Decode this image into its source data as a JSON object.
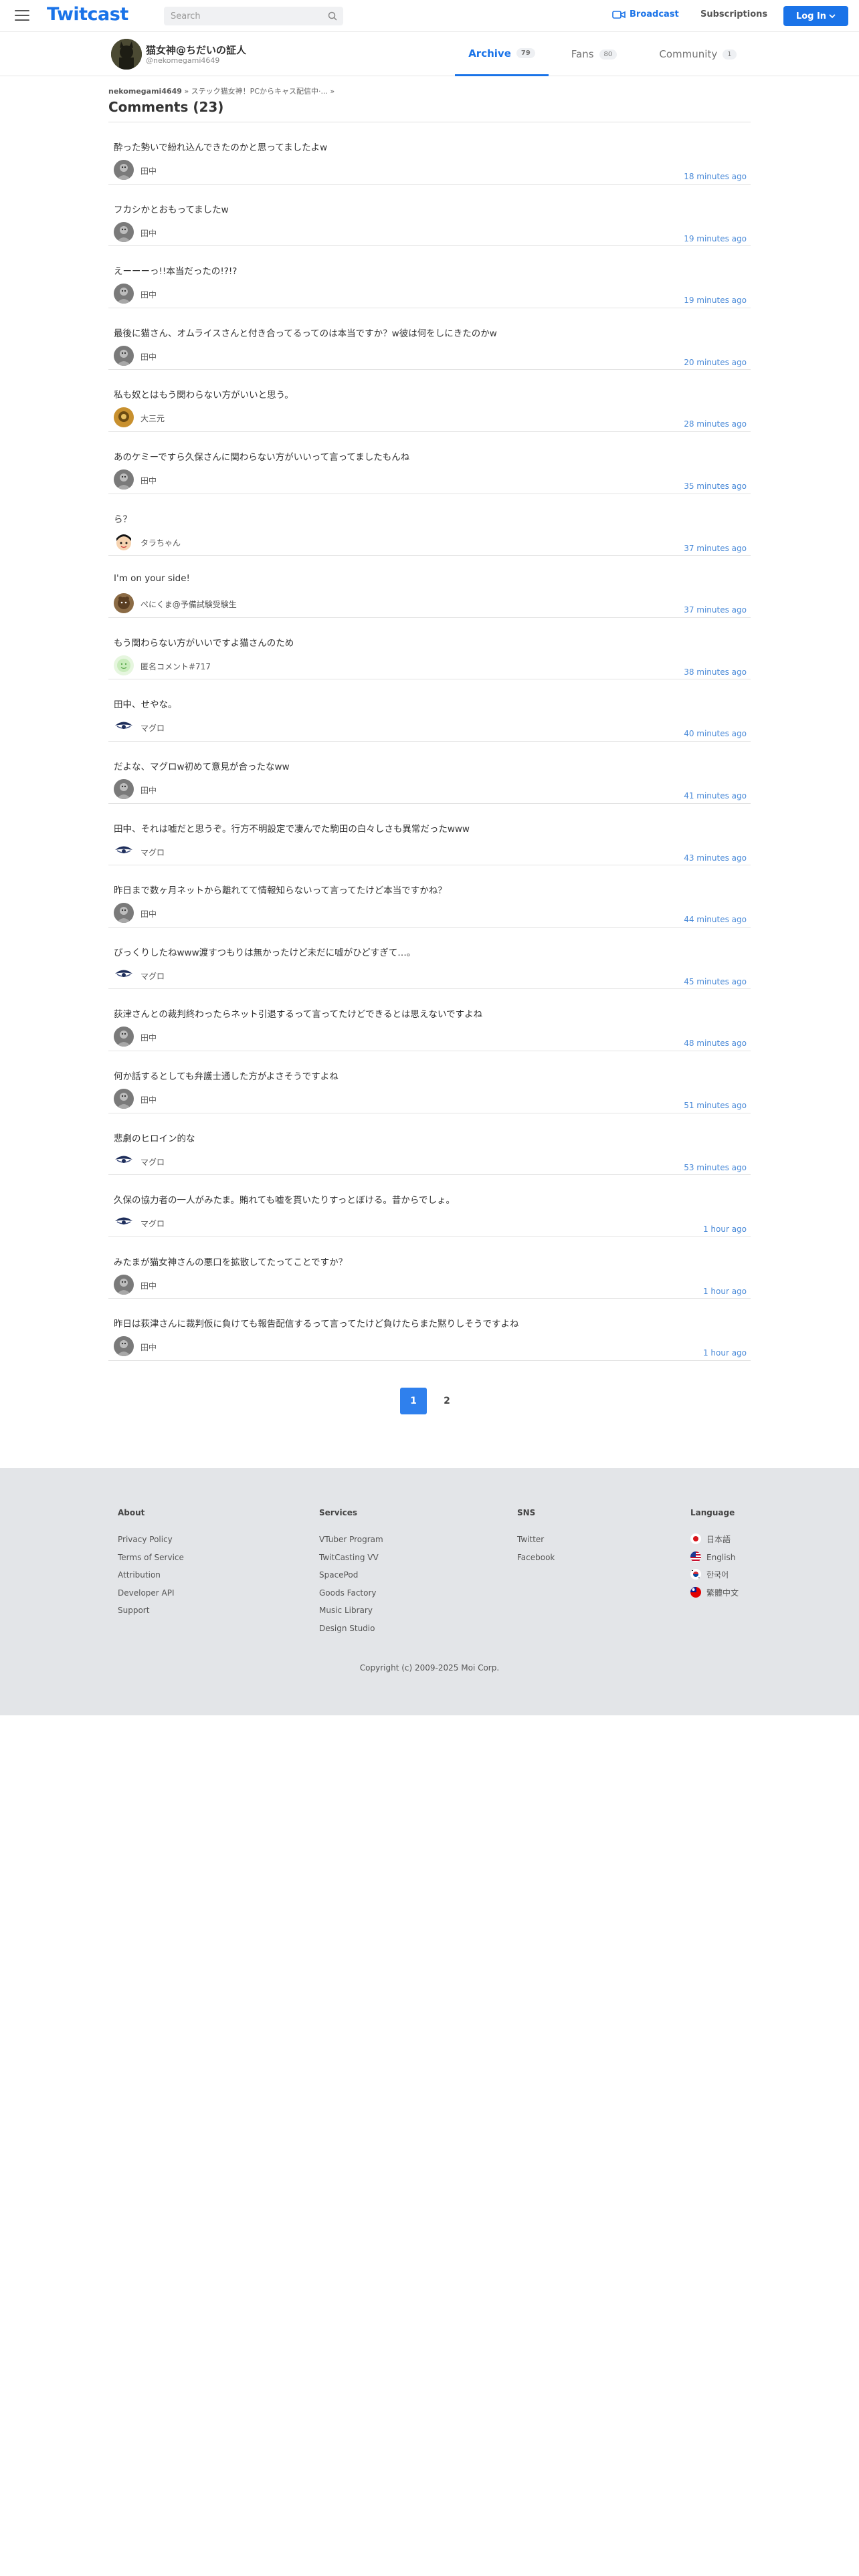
{
  "header": {
    "logo": "Twitcast",
    "search_placeholder": "Search",
    "broadcast_label": "Broadcast",
    "subscriptions_label": "Subscriptions",
    "login_label": "Log In",
    "accent": "#1a73e8"
  },
  "profile": {
    "name": "猫女神@ちだいの証人",
    "handle": "@nekomegami4649",
    "tabs": [
      {
        "label": "Archive",
        "count": "79",
        "active": true
      },
      {
        "label": "Fans",
        "count": "80",
        "active": false
      },
      {
        "label": "Community",
        "count": "1",
        "active": false
      }
    ]
  },
  "breadcrumb": {
    "user": "nekomegami4649",
    "sep1": "»",
    "movie": "ステック猫女神！PCからキャス配信中·...",
    "sep2": "»"
  },
  "comments_title": "Comments (23)",
  "comments": [
    {
      "text": "酔った勢いで紛れ込んできたのかと思ってましたよw",
      "user": "田中",
      "time": "18 minutes ago",
      "avatar": "gray"
    },
    {
      "text": "フカシかとおもってましたw",
      "user": "田中",
      "time": "19 minutes ago",
      "avatar": "gray"
    },
    {
      "text": "えーーーっ!!本当だったの!?!?",
      "user": "田中",
      "time": "19 minutes ago",
      "avatar": "gray"
    },
    {
      "text": "最後に猫さん、オムライスさんと付き合ってるってのは本当ですか？w彼は何をしにきたのかw",
      "user": "田中",
      "time": "20 minutes ago",
      "avatar": "gray"
    },
    {
      "text": "私も奴とはもう関わらない方がいいと思う。",
      "user": "大三元",
      "time": "28 minutes ago",
      "avatar": "gold"
    },
    {
      "text": "あのケミーですら久保さんに関わらない方がいいって言ってましたもんね",
      "user": "田中",
      "time": "35 minutes ago",
      "avatar": "gray"
    },
    {
      "text": "ら？",
      "user": "タラちゃん",
      "time": "37 minutes ago",
      "avatar": "face"
    },
    {
      "text": "I'm on your side!",
      "user": "ぺにくま@予備試験受験生",
      "time": "37 minutes ago",
      "avatar": "brown"
    },
    {
      "text": "もう関わらない方がいいですよ猫さんのため",
      "user": "匿名コメント#717",
      "time": "38 minutes ago",
      "avatar": "green"
    },
    {
      "text": "田中、せやな。",
      "user": "マグロ",
      "time": "40 minutes ago",
      "avatar": "eye"
    },
    {
      "text": "だよな、マグロw初めて意見が合ったなww",
      "user": "田中",
      "time": "41 minutes ago",
      "avatar": "gray"
    },
    {
      "text": "田中、それは嘘だと思うぞ。行方不明設定で凄んでた駒田の白々しさも異常だったwww",
      "user": "マグロ",
      "time": "43 minutes ago",
      "avatar": "eye"
    },
    {
      "text": "昨日まで数ヶ月ネットから離れてて情報知らないって言ってたけど本当ですかね？",
      "user": "田中",
      "time": "44 minutes ago",
      "avatar": "gray"
    },
    {
      "text": "びっくりしたねwww渡すつもりは無かったけど未だに嘘がひどすぎて…。",
      "user": "マグロ",
      "time": "45 minutes ago",
      "avatar": "eye"
    },
    {
      "text": "荻津さんとの裁判終わったらネット引退するって言ってたけどできるとは思えないですよね",
      "user": "田中",
      "time": "48 minutes ago",
      "avatar": "gray"
    },
    {
      "text": "何か話するとしても弁護士通した方がよさそうですよね",
      "user": "田中",
      "time": "51 minutes ago",
      "avatar": "gray"
    },
    {
      "text": "悲劇のヒロイン的な",
      "user": "マグロ",
      "time": "53 minutes ago",
      "avatar": "eye"
    },
    {
      "text": "久保の協力者の一人がみたま。賄れても嘘を貫いたりすっとぼける。昔からでしょ。",
      "user": "マグロ",
      "time": "1 hour ago",
      "avatar": "eye"
    },
    {
      "text": "みたまが猫女神さんの悪口を拡散してたってことですか？",
      "user": "田中",
      "time": "1 hour ago",
      "avatar": "gray"
    },
    {
      "text": "昨日は荻津さんに裁判仮に負けても報告配信するって言ってたけど負けたらまた黙りしそうですよね",
      "user": "田中",
      "time": "1 hour ago",
      "avatar": "gray"
    }
  ],
  "pagination": [
    "1",
    "2"
  ],
  "footer": {
    "about": {
      "heading": "About",
      "links": [
        "Privacy Policy",
        "Terms of Service",
        "Attribution",
        "Developer API",
        "Support"
      ]
    },
    "services": {
      "heading": "Services",
      "links": [
        "VTuber Program",
        "TwitCasting VV",
        "SpacePod",
        "Goods Factory",
        "Music Library",
        "Design Studio"
      ]
    },
    "sns": {
      "heading": "SNS",
      "links": [
        "Twitter",
        "Facebook"
      ]
    },
    "language": {
      "heading": "Language",
      "links": [
        "日本語",
        "English",
        "한국어",
        "繁體中文"
      ]
    },
    "copyright": "Copyright (c) 2009-2025 Moi Corp."
  }
}
